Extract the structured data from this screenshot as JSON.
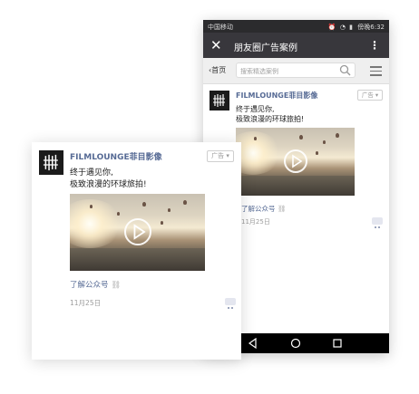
{
  "status_bar": {
    "carrier": "中国移动",
    "time": "傍晚6:32"
  },
  "title_bar": {
    "title": "朋友圈广告案例",
    "close_glyph": "✕",
    "more_glyph": "⋮"
  },
  "nav_bar": {
    "back_label": "首页",
    "search_placeholder": "搜索精选案例"
  },
  "post": {
    "account_name": "FILMLOUNGE菲目影像",
    "ad_tag": "广告",
    "text_line1": "终于遇见你,",
    "text_line2": "极致浪漫的环球旅拍!",
    "link_label": "了解公众号",
    "link_icon": "🔗",
    "date": "11月25日",
    "comment_icon": "comment-icon"
  },
  "colors": {
    "account_name": "#576b95",
    "title_bar": "#38373c",
    "status_bar": "#2b2b2d",
    "nav_bar": "#efefef"
  }
}
